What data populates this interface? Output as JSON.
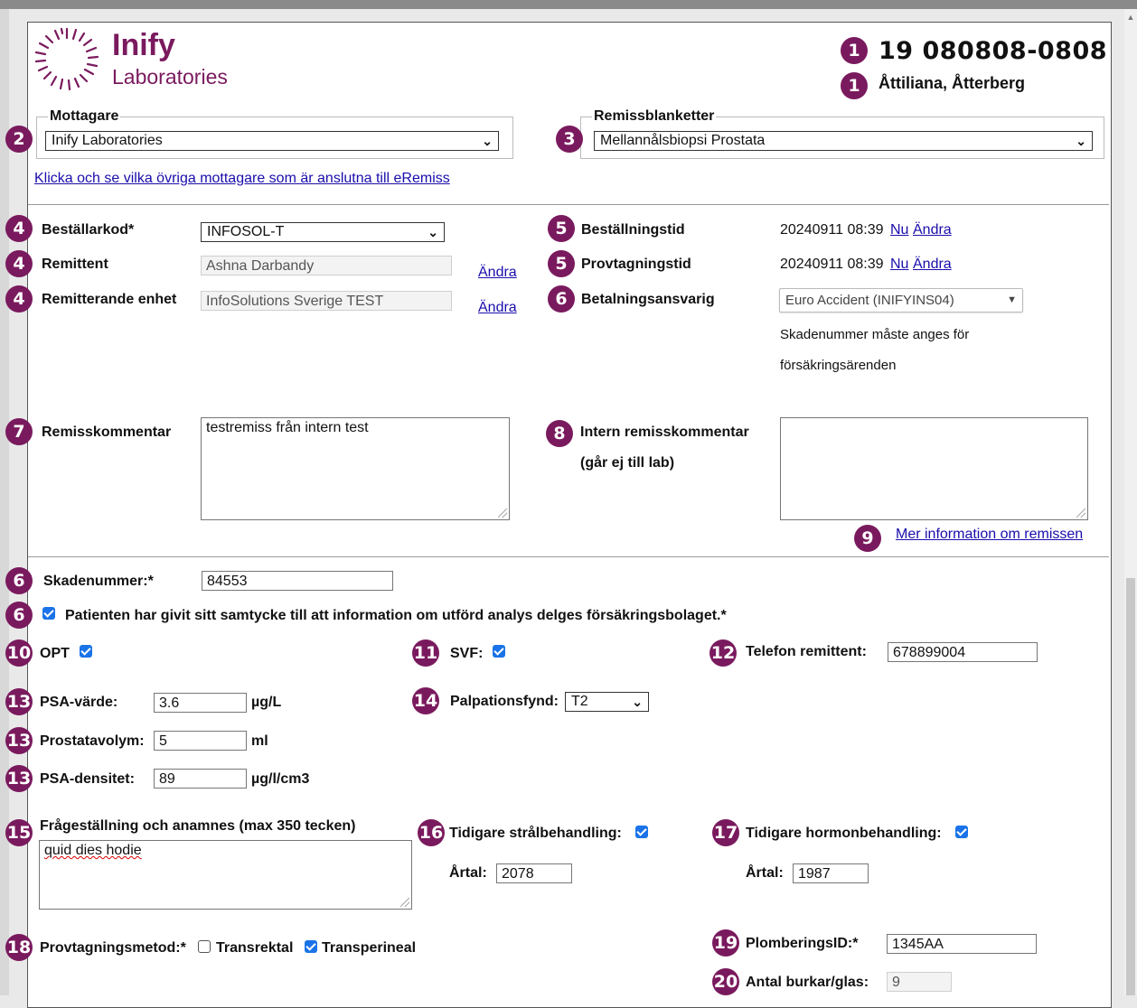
{
  "header": {
    "logo_name": "Inify",
    "logo_sub": "Laboratories",
    "patient_id": "19 080808-0808",
    "patient_name": "Åttiliana, Åtterberg"
  },
  "badges": {
    "patient_id": "1",
    "patient_name": "1",
    "mottagare": "2",
    "remissblankett": "3",
    "bestallarkod": "4",
    "remittent": "4",
    "remitterande_enhet": "4",
    "bestallningstid": "5",
    "provtagningstid": "5",
    "betalningsansvarig": "6",
    "remisskommentar": "7",
    "intern_kommentar": "8",
    "mer_info": "9",
    "skadenummer": "6",
    "samtycke": "6",
    "opt": "10",
    "svf": "11",
    "telefon": "12",
    "psa_varde": "13",
    "prostatavolym": "13",
    "psa_densitet": "13",
    "palpation": "14",
    "fragestallning": "15",
    "tidigare_straal": "16",
    "tidigare_hormon": "17",
    "provtagningsmetod": "18",
    "plombering": "19",
    "antal_burkar": "20"
  },
  "mottagare": {
    "legend": "Mottagare",
    "value": "Inify Laboratories"
  },
  "remissblanketter": {
    "legend": "Remissblanketter",
    "value": "Mellannålsbiopsi Prostata"
  },
  "other_recipients_link": "Klicka och se vilka övriga mottagare som är anslutna till eRemiss",
  "left": {
    "bestallarkod_label": "Beställarkod*",
    "bestallarkod_value": "INFOSOL-T",
    "remittent_label": "Remittent",
    "remittent_value": "Ashna Darbandy",
    "remitterande_enhet_label": "Remitterande enhet",
    "remitterande_enhet_value": "InfoSolutions Sverige TEST",
    "andra": "Ändra"
  },
  "right": {
    "bestallningstid_label": "Beställningstid",
    "bestallningstid_value": "20240911 08:39",
    "provtagningstid_label": "Provtagningstid",
    "provtagningstid_value": "20240911 08:39",
    "nu": "Nu",
    "andra": "Ändra",
    "betalningsansvarig_label": "Betalningsansvarig",
    "betalningsansvarig_value": "Euro Accident (INIFYINS04)",
    "skade_note_1": "Skadenummer måste anges för",
    "skade_note_2": "försäkringsärenden"
  },
  "comments": {
    "remisskommentar_label": "Remisskommentar",
    "remisskommentar_value": "testremiss från intern test",
    "intern_label_1": "Intern remisskommentar",
    "intern_label_2": "(går ej till lab)",
    "intern_value": "",
    "mer_info_link": "Mer information om remissen"
  },
  "form": {
    "skadenummer_label": "Skadenummer:*",
    "skadenummer_value": "84553",
    "samtycke_label": "Patienten har givit sitt samtycke till att information om utförd analys delges försäkringsbolaget.*",
    "samtycke_checked": true,
    "opt_label": "OPT",
    "opt_checked": true,
    "svf_label": "SVF:",
    "svf_checked": true,
    "telefon_label": "Telefon remittent:",
    "telefon_value": "678899004",
    "psa_label": "PSA-värde:",
    "psa_value": "3.6",
    "psa_unit": "µg/L",
    "palpation_label": "Palpationsfynd:",
    "palpation_value": "T2",
    "prostatavolym_label": "Prostatavolym:",
    "prostatavolym_value": "5",
    "prostatavolym_unit": "ml",
    "psa_densitet_label": "PSA-densitet:",
    "psa_densitet_value": "89",
    "psa_densitet_unit": "µg/l/cm3",
    "fragestallning_label": "Frågeställning och anamnes (max 350 tecken)",
    "fragestallning_value": "quid dies hodie",
    "straal_label": "Tidigare strålbehandling:",
    "straal_checked": true,
    "straal_artal_label": "Årtal:",
    "straal_artal_value": "2078",
    "hormon_label": "Tidigare hormonbehandling:",
    "hormon_checked": true,
    "hormon_artal_label": "Årtal:",
    "hormon_artal_value": "1987",
    "provtagningsmetod_label": "Provtagningsmetod:*",
    "transrektal_label": "Transrektal",
    "transrektal_checked": false,
    "transperineal_label": "Transperineal",
    "transperineal_checked": true,
    "plombering_label": "PlomberingsID:*",
    "plombering_value": "1345AA",
    "antal_label": "Antal burkar/glas:",
    "antal_value": "9"
  }
}
